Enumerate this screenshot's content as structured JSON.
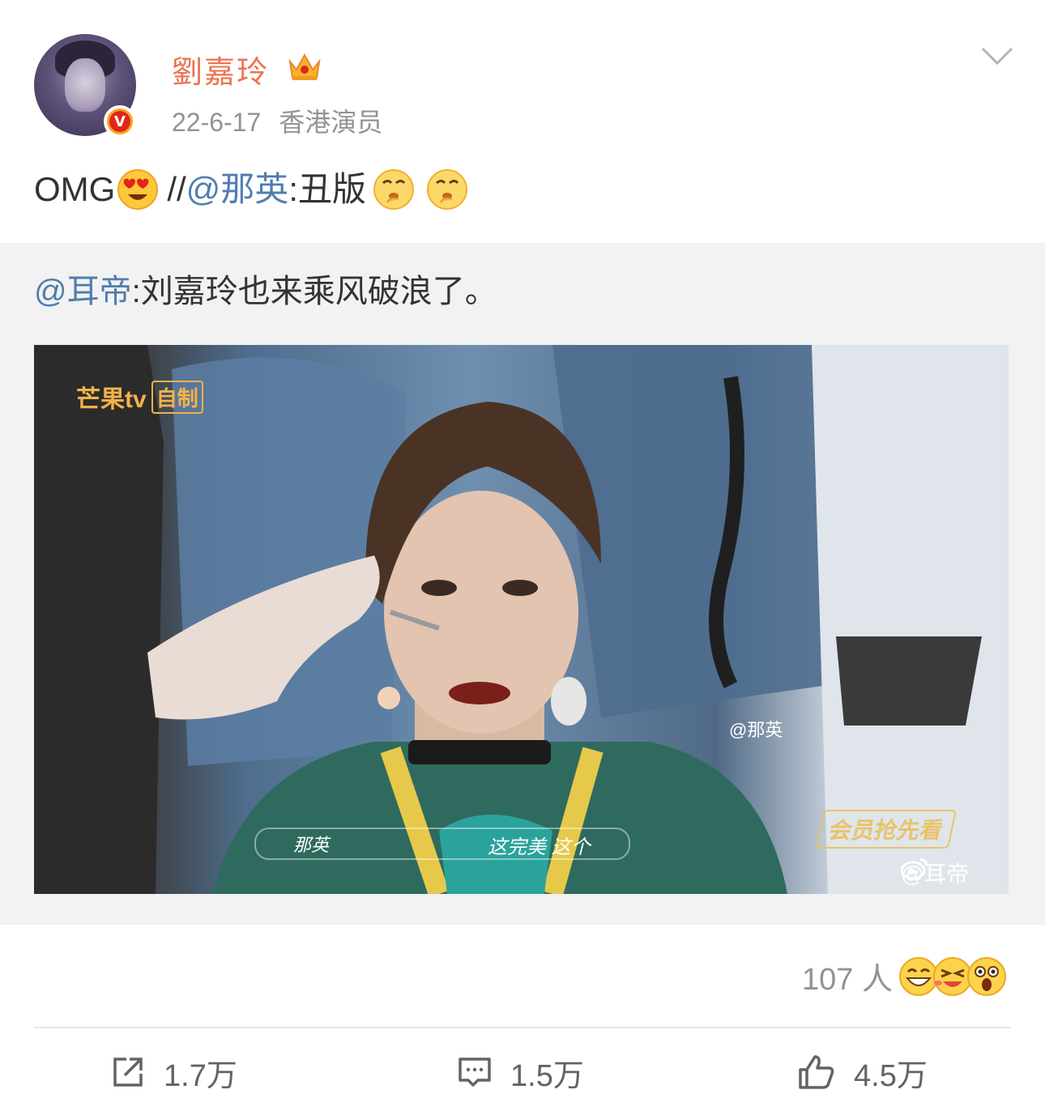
{
  "header": {
    "username": "劉嘉玲",
    "date": "22-6-17",
    "source": "香港演员",
    "verified_badge": "V"
  },
  "post": {
    "prefix": "OMG",
    "separator": "//",
    "mention": "@那英",
    "colon_text": ":丑版"
  },
  "repost": {
    "mention": "@耳帝",
    "text": ":刘嘉玲也来乘风破浪了。",
    "media": {
      "watermark_brand": "芒果tv",
      "watermark_tag": "自制",
      "watermark_user": "@那英",
      "vip_badge": "会员抢先看",
      "subtitle_speaker": "那英",
      "subtitle_text": "这完美 这个",
      "repost_watermark": "@耳帝"
    }
  },
  "reactions": {
    "count": "107 人",
    "emojis": [
      "grin-icon",
      "laugh-cry-icon",
      "surprised-icon"
    ]
  },
  "actions": {
    "repost_count": "1.7万",
    "comment_count": "1.5万",
    "like_count": "4.5万"
  },
  "colors": {
    "username": "#eb7350",
    "link": "#507daf",
    "muted": "#939393",
    "repost_bg": "#f2f2f2"
  }
}
